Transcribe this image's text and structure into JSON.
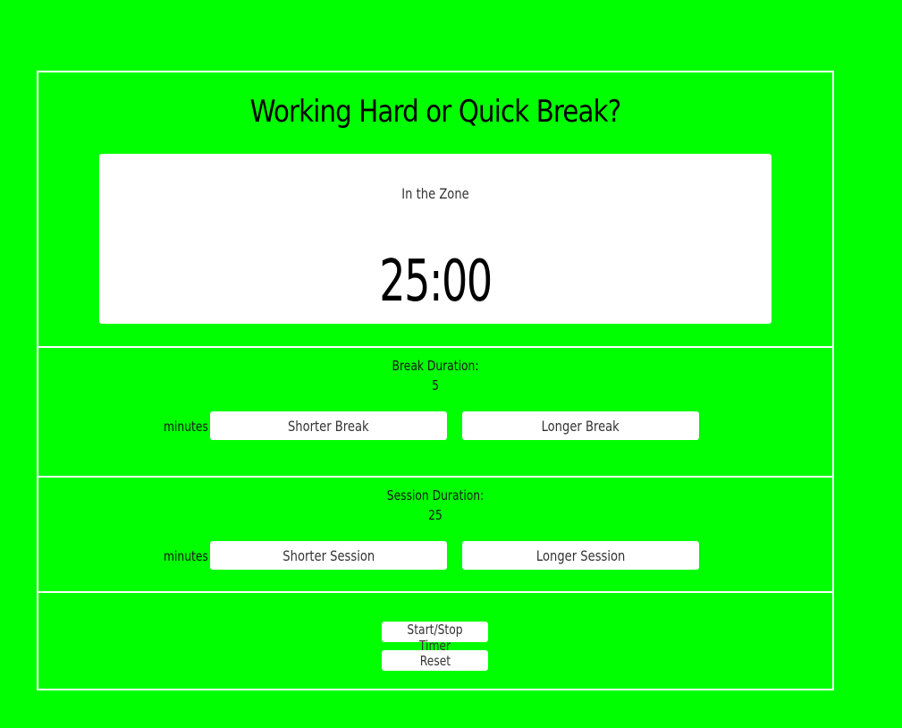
{
  "title": "Working Hard or Quick Break?",
  "timer": {
    "label": "In the Zone",
    "value": "25:00"
  },
  "break": {
    "label": "Break Duration:",
    "value": "5",
    "unit": "minutes",
    "decrease_label": "Shorter Break",
    "increase_label": "Longer Break"
  },
  "session": {
    "label": "Session Duration:",
    "value": "25",
    "unit": "minutes",
    "decrease_label": "Shorter Session",
    "increase_label": "Longer Session"
  },
  "controls": {
    "start_stop_label": "Start/Stop Timer",
    "reset_label": "Reset"
  },
  "colors": {
    "background": "#00ff00",
    "border": "#ffffff",
    "card": "#ffffff",
    "text": "#1a1a1a"
  }
}
